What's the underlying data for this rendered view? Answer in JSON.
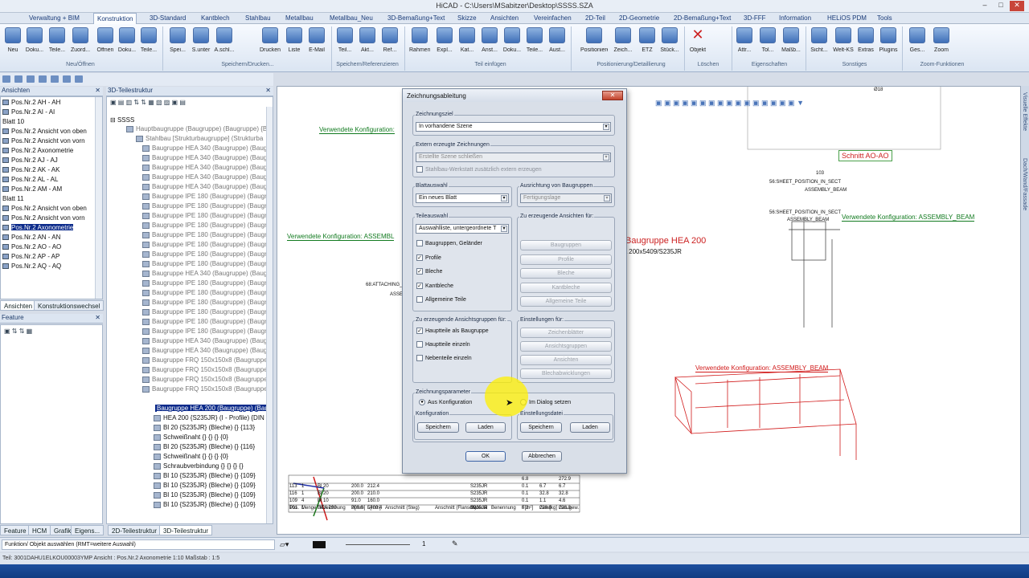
{
  "window": {
    "title": "HiCAD - C:\\Users\\MSabitzer\\Desktop\\SSSS.SZA"
  },
  "menu": [
    "Verwaltung + BIM",
    "Konstruktion",
    "3D-Standard",
    "Kantblech",
    "Stahlbau",
    "Metallbau",
    "Metallbau_Neu",
    "3D-Bemaßung+Text",
    "Skizze",
    "Ansichten",
    "Vereinfachen",
    "2D-Teil",
    "2D-Geometrie",
    "2D-Bemaßung+Text",
    "3D-FFF",
    "Information",
    "HELiOS PDM",
    "Tools"
  ],
  "ribbon": {
    "buttons": [
      "Neu",
      "Doku...",
      "Teile...",
      "Zuord...",
      "Öffnen",
      "Doku...",
      "Teile...",
      "Spei...",
      "S.unter",
      "A.schl...",
      "Drucken",
      "Liste",
      "E-Mail",
      "Teil...",
      "Akt...",
      "Ref...",
      "Rahmen",
      "Expl...",
      "Kat...",
      "Anst...",
      "Doku...",
      "Teile...",
      "Aust...",
      "Positionieren",
      "Zeich...",
      "ETZ",
      "Stück...",
      "Objekt",
      "Attr...",
      "Tol...",
      "Maßb...",
      "Sicht...",
      "Welt-KS",
      "Extras",
      "Plugins",
      "Ges...",
      "Zoom"
    ],
    "groups": [
      "Neu/Öffnen",
      "Speichern/Drucken...",
      "Speichern/Referenzieren",
      "Teil einfügen",
      "Positionierung/Detaillierung",
      "Löschen",
      "Eigenschaften",
      "Sonstiges",
      "Zoom-Funktionen"
    ]
  },
  "ansichten": {
    "title": "Ansichten",
    "items": [
      "Pos.Nr.2 AH - AH",
      "Pos.Nr.2 AI - AI",
      "Blatt 10",
      "Pos.Nr.2 Ansicht von oben",
      "Pos.Nr.2 Ansicht von vorn",
      "Pos.Nr.2 Axonometrie",
      "Pos.Nr.2 AJ - AJ",
      "Pos.Nr.2 AK - AK",
      "Pos.Nr.2 AL - AL",
      "Pos.Nr.2 AM - AM",
      "Blatt 11",
      "Pos.Nr.2 Ansicht von oben",
      "Pos.Nr.2 Ansicht von vorn",
      "Pos.Nr.2 Axonometrie",
      "Pos.Nr.2 AN - AN",
      "Pos.Nr.2 AO - AO",
      "Pos.Nr.2 AP - AP",
      "Pos.Nr.2 AQ - AQ"
    ],
    "tabs": [
      "Ansichten",
      "Konstruktionswechsel"
    ]
  },
  "feature": {
    "title": "Feature"
  },
  "teilestruktur": {
    "title": "3D-Teilestruktur",
    "root": "SSSS",
    "items": [
      "Hauptbaugruppe (Baugruppe) (Baugruppe) {Ba",
      "Stahlbau [Strukturbaugruppe] (Strukturba",
      "Baugruppe HEA 340 (Baugruppe) (Baugruppe) (Bau",
      "Baugruppe HEA 340 (Baugruppe) (Baugruppe) (Bau",
      "Baugruppe HEA 340 (Baugruppe) (Baugruppe) (Bau",
      "Baugruppe HEA 340 (Baugruppe) (Baugruppe) (Bau",
      "Baugruppe HEA 340 (Baugruppe) (Baugruppe) (Bau",
      "Baugruppe IPE 180 (Baugruppe) (Baugruppe) (Bau",
      "Baugruppe IPE 180 (Baugruppe) (Baugruppe) (Bau",
      "Baugruppe IPE 180 (Baugruppe) (Baugruppe) (Bau",
      "Baugruppe IPE 180 (Baugruppe) (Baugruppe) (Bau",
      "Baugruppe IPE 180 (Baugruppe) (Baugruppe) (Bau",
      "Baugruppe IPE 180 (Baugruppe) (Baugruppe) (Bau",
      "Baugruppe IPE 180 (Baugruppe) (Baugruppe) (Bau",
      "Baugruppe IPE 180 (Baugruppe) (Baugruppe) (Bau",
      "Baugruppe HEA 340 (Baugruppe) (Baugruppe) (Bau",
      "Baugruppe IPE 180 (Baugruppe) (Baugruppe) (Bau",
      "Baugruppe IPE 180 (Baugruppe) (Baugruppe) (Bau",
      "Baugruppe IPE 180 (Baugruppe) (Baugruppe) (Bau",
      "Baugruppe IPE 180 (Baugruppe) (Baugruppe) (Bau",
      "Baugruppe IPE 180 (Baugruppe) (Baugruppe) (Bau",
      "Baugruppe IPE 180 (Baugruppe) (Baugruppe) (Bau",
      "Baugruppe HEA 340 (Baugruppe) (Baugruppe) (Bau",
      "Baugruppe HEA 340 (Baugruppe) (Baugruppe) (Bau",
      "Baugruppe FRQ 150x150x8 (Baugruppe) (Baugrupp",
      "Baugruppe FRQ 150x150x8 (Baugruppe) (Baugrupp",
      "Baugruppe FRQ 150x150x8 (Baugruppe) (Baugrupp",
      "Baugruppe FRQ 150x150x8 (Baugruppe) (Baugrupp"
    ],
    "selected": "Baugruppe HEA 200 (Baugruppe) (Bau",
    "children": [
      "HEA 200 {S235JR} (I - Profile) {DIN",
      "Bl 20 {S235JR} (Bleche) {} {113}",
      "Schweißnaht {} {} {} {0}",
      "Bl 20 {S235JR} (Bleche) {} {116}",
      "Schweißnaht {} {} {} {0}",
      "Schraubverbindung {} {} {} {}",
      "Bl 10 {S235JR} (Bleche) {} {109}",
      "Bl 10 {S235JR} (Bleche) {} {109}",
      "Bl 10 {S235JR} (Bleche) {} {109}",
      "Bl 10 {S235JR} (Bleche) {} {109}"
    ],
    "tabs": [
      "Feature",
      "HCM",
      "Grafik",
      "Eigens...",
      "2D-Teilestruktur",
      "3D-Teilestruktur"
    ]
  },
  "dialog": {
    "title": "Zeichnungsableitung",
    "zeichnungsziel_label": "Zeichnungsziel",
    "zeichnungsziel_value": "In vorhandene Szene",
    "extern_label": "Extern erzeugte Zeichnungen",
    "extern_value": "Erstellte Szene schließen",
    "extern_check": "Stahlbau-Werkstatt zusätzlich extern erzeugen",
    "blattauswahl_label": "Blattauswahl",
    "blattauswahl_value": "Ein neues Blatt",
    "ausrichtung_label": "Ausrichtung von Baugruppen",
    "ausrichtung_value": "Fertigungslage",
    "teileauswahl_label": "Teileauswahl",
    "teileauswahl_value": "Auswahlliste, untergeordnete T",
    "teile_checks": [
      {
        "label": "Baugruppen, Geländer",
        "checked": false
      },
      {
        "label": "Profile",
        "checked": true
      },
      {
        "label": "Bleche",
        "checked": true
      },
      {
        "label": "Kantbleche",
        "checked": true
      },
      {
        "label": "Allgemeine Teile",
        "checked": false
      }
    ],
    "ansichten_label": "Zu erzeugende Ansichten für:",
    "ansichten_buttons": [
      "Baugruppen",
      "Profile",
      "Bleche",
      "Kantbleche",
      "Allgemeine Teile"
    ],
    "gruppen_label": "Zu erzeugende Ansichtsgruppen für:",
    "gruppen_checks": [
      {
        "label": "Hauptteile als Baugruppe",
        "checked": true
      },
      {
        "label": "Hauptteile einzeln",
        "checked": false
      },
      {
        "label": "Nebenteile einzeln",
        "checked": false
      }
    ],
    "einstellungen_label": "Einstellungen für:",
    "einstellungen_buttons": [
      "Zeichenblätter",
      "Ansichtsgruppen",
      "Ansichten",
      "Blechabwicklungen"
    ],
    "parameter_label": "Zeichnungsparameter",
    "radio_1": "Aus Konfiguration",
    "radio_2": "Im Dialog setzen",
    "konfiguration_label": "Konfiguration",
    "einstellungsdatei_label": "Einstellungsdatei",
    "speichern": "Speichern",
    "laden": "Laden",
    "ok": "OK",
    "abbrechen": "Abbrechen"
  },
  "canvas": {
    "labels": {
      "cfg1": "Verwendete Konfiguration:",
      "cfg2": "Verwendete Konfiguration: ASSEMBL",
      "cfg3": "Verwendete Konfiguration: ASSEMBLY_BEAM",
      "cfg4": "Verwendete Konfiguration: ASSEMBLY_BEAM",
      "schnitt": "Schnitt AO-AO",
      "bg": "Baugruppe HEA 200",
      "bgsub": "A 200x5409/S235JR",
      "attach": "68:ATTACHING_",
      "assy": "ASSE",
      "sheet1": "56:SHEET_POSITION_IN_SECT",
      "assembly_beam": "ASSEMBLY_BEAM",
      "n103": "103",
      "n18": "Ø18",
      "sheet_stack": "56:SHEET_POSITION_IN_SECT"
    },
    "bom": {
      "headers": [
        "Pos.",
        "Menge",
        "Bezeichnung",
        "B[mm]",
        "L[mm]",
        "Anschnitt (Steg)",
        "Anschnitt (Flansch)",
        "Material",
        "Benennung",
        "F[m²]",
        "Gew[kg]",
        "Ges.gew."
      ],
      "rows": [
        [
          "113",
          "1",
          "Bl 20",
          "200.0",
          "212.4",
          "",
          "",
          "S235JR",
          "",
          "0.1",
          "6.7",
          "6.7"
        ],
        [
          "116",
          "1",
          "Bl 20",
          "200.0",
          "210.0",
          "",
          "",
          "S235JR",
          "",
          "0.1",
          "32.8",
          "32.8"
        ],
        [
          "109",
          "4",
          "Bl 10",
          "91.0",
          "160.0",
          "",
          "",
          "S235JR",
          "",
          "0.1",
          "1.1",
          "4.6"
        ],
        [
          "101",
          "1",
          "HEA 200",
          "200.0",
          "5409.4",
          "",
          "",
          "S235JR",
          "",
          "6.2",
          "228.8",
          "228.8"
        ]
      ],
      "top_row": [
        "6.8",
        "272.9"
      ]
    }
  },
  "sidetabs": [
    "Visuelle Effekte",
    "Dach/Wand/Fassade"
  ],
  "cmdbar": {
    "prompt": "Funktion/ Objekt auswählen (RMT=weitere Auswahl)",
    "linewidth": "1"
  },
  "status": {
    "text": "Teil: 3001DAHU1ELKOU00003YMP   Ansicht : Pos.Nr.2 Axonometrie 1:10   Maßstab : 1:5"
  },
  "colors": {
    "accent": "#0b2a8a",
    "config_green": "#117a1f",
    "drawing_red": "#d11a1a"
  }
}
